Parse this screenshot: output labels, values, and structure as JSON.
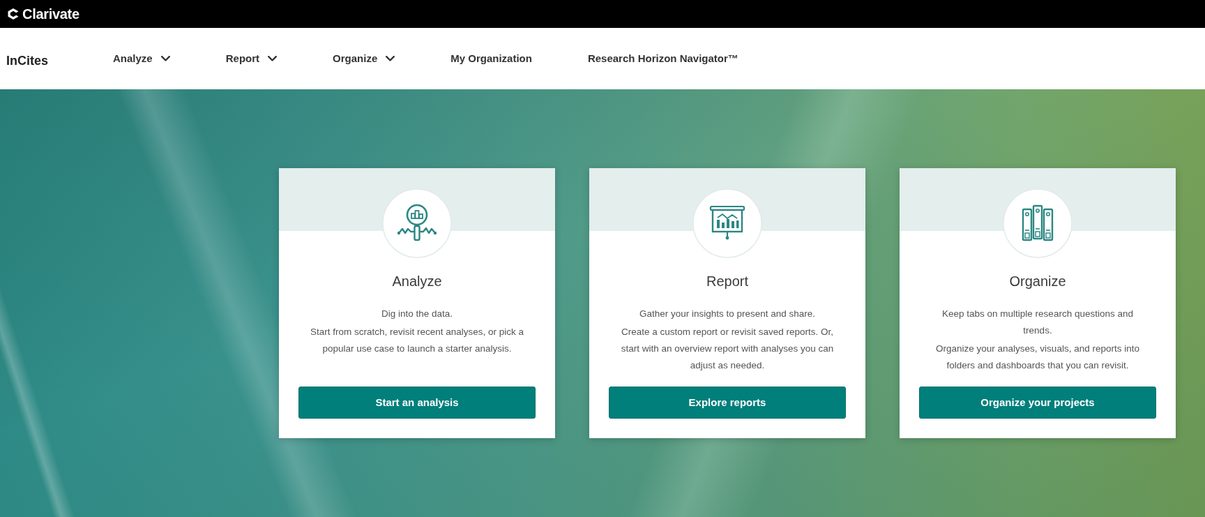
{
  "brand_bar": {
    "logo_text": "Clarivate"
  },
  "navbar": {
    "product": "InCites",
    "items": [
      {
        "label": "Analyze",
        "dropdown": true
      },
      {
        "label": "Report",
        "dropdown": true
      },
      {
        "label": "Organize",
        "dropdown": true
      },
      {
        "label": "My Organization",
        "dropdown": false
      },
      {
        "label": "Research Horizon Navigator™",
        "dropdown": false
      }
    ]
  },
  "cards": [
    {
      "kind": "analyze",
      "title": "Analyze",
      "summary": "Dig into the data.",
      "description": "Start from scratch, revisit recent analyses, or pick a popular use case to launch a starter analysis.",
      "button": "Start an analysis"
    },
    {
      "kind": "report",
      "title": "Report",
      "summary": "Gather your insights to present and share.",
      "description": "Create a custom report or revisit saved reports. Or, start with an overview report with analyses you can adjust as needed.",
      "button": "Explore reports"
    },
    {
      "kind": "organize",
      "title": "Organize",
      "summary": "Keep tabs on multiple research questions and trends.",
      "description": "Organize your analyses, visuals, and reports into folders and dashboards that you can revisit.",
      "button": "Organize your projects"
    }
  ]
}
